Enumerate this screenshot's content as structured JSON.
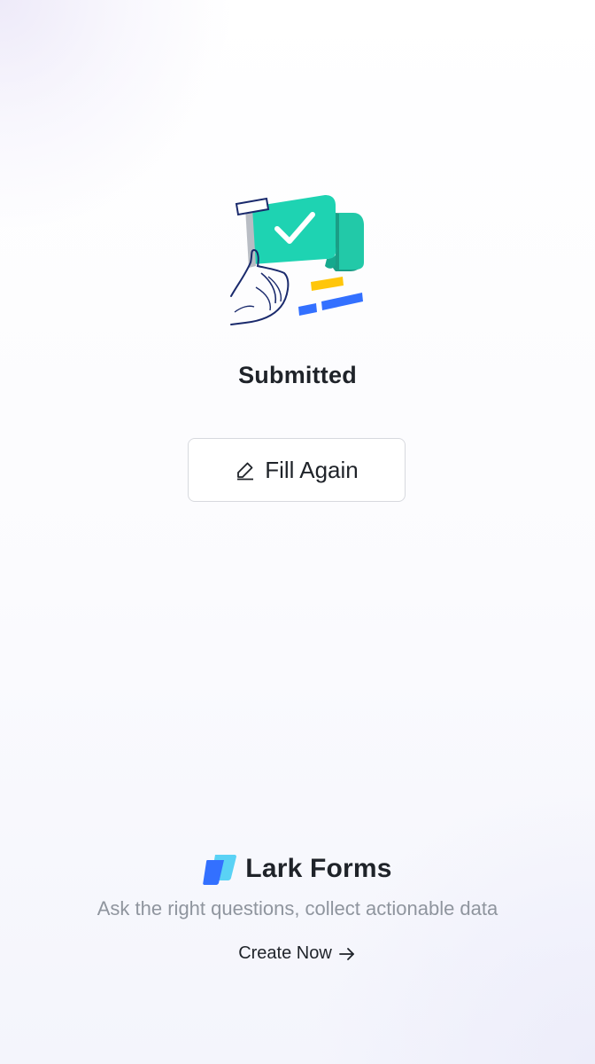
{
  "result": {
    "title": "Submitted",
    "illustration_icon": "flag-checkmark-illustration"
  },
  "actions": {
    "fill_again_label": "Fill Again",
    "fill_again_icon": "edit-pencil-icon"
  },
  "brand": {
    "name": "Lark Forms",
    "logo_icon": "lark-forms-logo",
    "tagline": "Ask the right questions, collect actionable data",
    "cta_label": "Create Now",
    "cta_icon": "arrow-right-icon"
  },
  "colors": {
    "accent_teal": "#1ed3b2",
    "logo_blue": "#3370ff",
    "logo_cyan": "#5ad2f5",
    "text_primary": "#1f2329",
    "text_secondary": "#8f959e",
    "border": "#d7d9de"
  }
}
